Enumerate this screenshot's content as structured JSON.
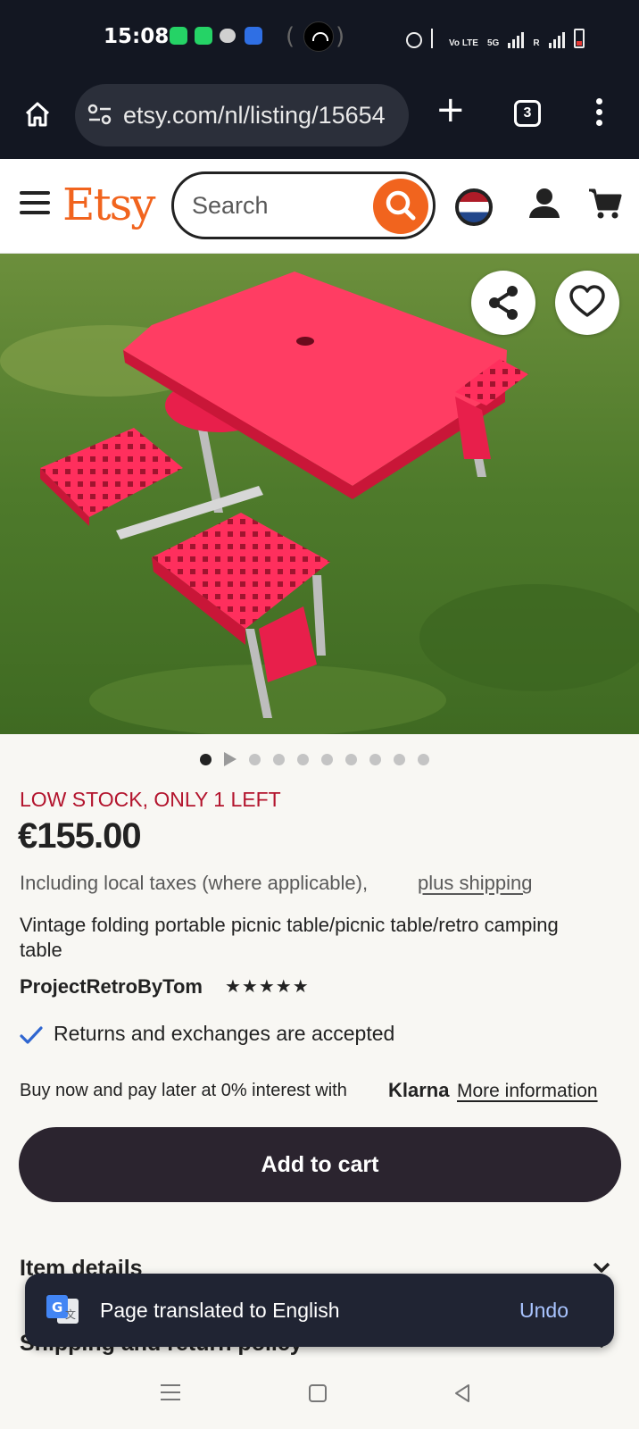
{
  "status_bar": {
    "time": "15:08",
    "network_label": "Vo LTE",
    "signal_label": "5G",
    "roaming": "R"
  },
  "browser": {
    "url": "etsy.com/nl/listing/15654",
    "tab_count": "3"
  },
  "header": {
    "logo": "Etsy",
    "search_placeholder": "Search"
  },
  "carousel": {
    "total": 10,
    "active_index": 0,
    "video_index": 1
  },
  "listing": {
    "stock_notice": "LOW STOCK, ONLY 1 LEFT",
    "price": "€155.00",
    "tax_note": "Including local taxes (where applicable),",
    "shipping_link": "plus shipping",
    "title": "Vintage folding portable picnic table/picnic table/retro camping table",
    "shop_name": "ProjectRetroByTom",
    "rating_stars": "★★★★★",
    "rating": 5,
    "returns": "Returns and exchanges are accepted",
    "klarna_text": "Buy now and pay later at 0% interest with",
    "klarna_brand": "Klarna",
    "klarna_link": "More information",
    "add_to_cart": "Add to cart",
    "item_details": "Item details",
    "shipping_policy": "Shipping and return policy"
  },
  "toast": {
    "message": "Page translated to English",
    "undo": "Undo"
  },
  "colors": {
    "accent": "#f1641e",
    "stock_red": "#b3142d",
    "cart_button": "#2b242f",
    "undo_blue": "#a9c4ff"
  }
}
